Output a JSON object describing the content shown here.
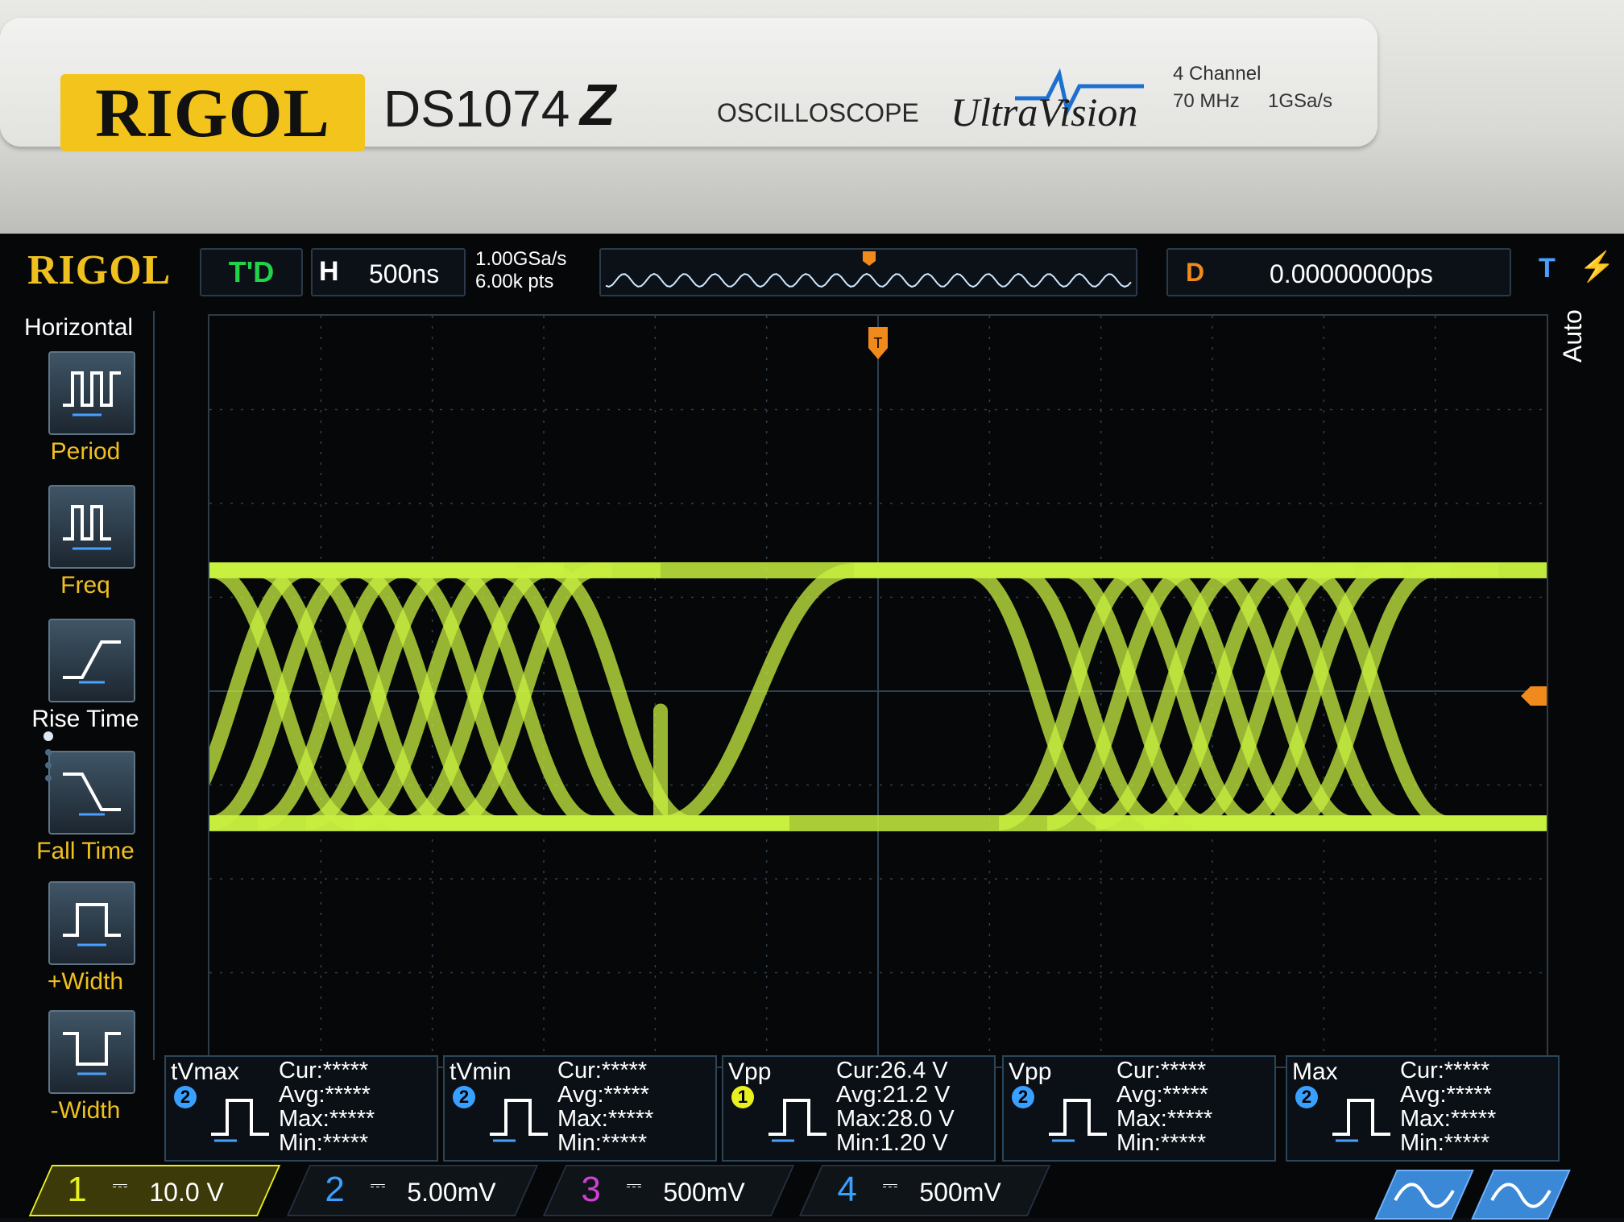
{
  "bezel": {
    "brand": "RIGOL",
    "model": "DS1074",
    "model_mark": "Z",
    "product_type": "OSCILLOSCOPE",
    "technology": "UltraVision",
    "spec_channels": "4 Channel",
    "spec_bandwidth": "70 MHz",
    "spec_samplerate": "1GSa/s"
  },
  "status": {
    "logo": "RIGOL",
    "run_state": "T'D",
    "hscale_label": "H",
    "hscale_value": "500ns",
    "sample_rate": "1.00GSa/s",
    "memory_depth": "6.00k pts",
    "delay_label": "D",
    "delay_value": "0.00000000ps",
    "trigger_source_label": "T",
    "trigger_mode": "Auto"
  },
  "menu": {
    "title": "Horizontal",
    "items": [
      {
        "label": "Period",
        "icon": "period-icon"
      },
      {
        "label": "Freq",
        "icon": "freq-icon"
      },
      {
        "label": "Rise Time",
        "icon": "rise-time-icon"
      },
      {
        "label": "Fall Time",
        "icon": "fall-time-icon"
      },
      {
        "label": "+Width",
        "icon": "positive-width-icon"
      },
      {
        "label": "-Width",
        "icon": "negative-width-icon"
      }
    ]
  },
  "measurements": [
    {
      "name": "tVmax",
      "channel": "2",
      "cur": "Cur:*****",
      "avg": "Avg:*****",
      "max": "Max:*****",
      "min": "Min:*****"
    },
    {
      "name": "tVmin",
      "channel": "2",
      "cur": "Cur:*****",
      "avg": "Avg:*****",
      "max": "Max:*****",
      "min": "Min:*****"
    },
    {
      "name": "Vpp",
      "channel": "1",
      "cur": "Cur:26.4 V",
      "avg": "Avg:21.2 V",
      "max": "Max:28.0 V",
      "min": "Min:1.20 V"
    },
    {
      "name": "Vpp",
      "channel": "2",
      "cur": "Cur:*****",
      "avg": "Avg:*****",
      "max": "Max:*****",
      "min": "Min:*****"
    },
    {
      "name": "Max",
      "channel": "2",
      "cur": "Cur:*****",
      "avg": "Avg:*****",
      "max": "Max:*****",
      "min": "Min:*****"
    }
  ],
  "channels": [
    {
      "num": "1",
      "scale": "10.0 V",
      "color": "#e8f020",
      "active": true
    },
    {
      "num": "2",
      "scale": "5.00mV",
      "color": "#3aa0ff",
      "active": false
    },
    {
      "num": "3",
      "scale": "500mV",
      "color": "#d040d0",
      "active": false
    },
    {
      "num": "4",
      "scale": "500mV",
      "color": "#3aa0ff",
      "active": false
    }
  ],
  "colors": {
    "trace": "#c8f040",
    "accent": "#f0c020",
    "trigger": "#f08a1d",
    "grid": "#2e4050"
  }
}
